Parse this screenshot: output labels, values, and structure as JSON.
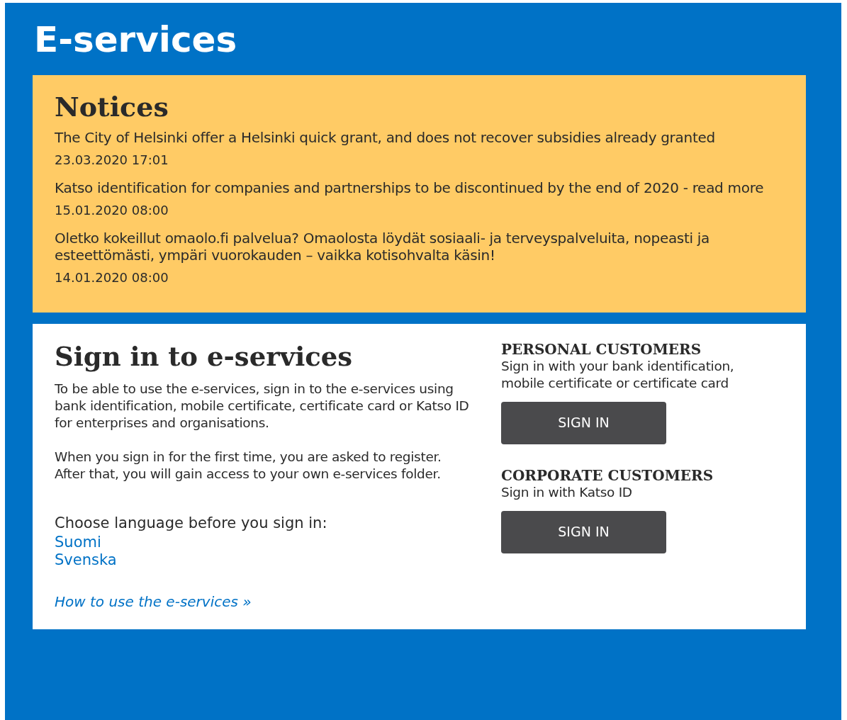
{
  "header": {
    "title": "E-services"
  },
  "notices": {
    "title": "Notices",
    "items": [
      {
        "text": "The City of Helsinki offer a Helsinki quick grant, and does not recover subsidies already granted",
        "date": "23.03.2020 17:01"
      },
      {
        "text": "Katso identification for companies and partnerships to be discontinued by the end of 2020 - read more",
        "date": "15.01.2020 08:00"
      },
      {
        "text": "Oletko kokeillut omaolo.fi palvelua? Omaolosta löydät sosiaali- ja terveyspalveluita, nopeasti ja esteettömästi, ympäri vuorokauden – vaikka kotisohvalta käsin!",
        "date": "14.01.2020 08:00"
      }
    ]
  },
  "sign_in": {
    "title": "Sign in to e-services",
    "paragraphs": [
      "To be able to use the e-services, sign in to the e-services using bank identification, mobile certificate, certificate card or Katso ID for enterprises and organisations.",
      "When you sign in for the first time, you are asked to register. After that, you will gain access to your own e-services folder."
    ],
    "language_prompt": "Choose language before you sign in:",
    "languages": [
      "Suomi",
      "Svenska"
    ],
    "help_link": "How to use the e-services »"
  },
  "customers": [
    {
      "title": "PERSONAL CUSTOMERS",
      "description": "Sign in with your bank identification, mobile certificate or certificate card",
      "button": "SIGN IN"
    },
    {
      "title": "CORPORATE CUSTOMERS",
      "description": "Sign in with Katso ID",
      "button": "SIGN IN"
    }
  ]
}
